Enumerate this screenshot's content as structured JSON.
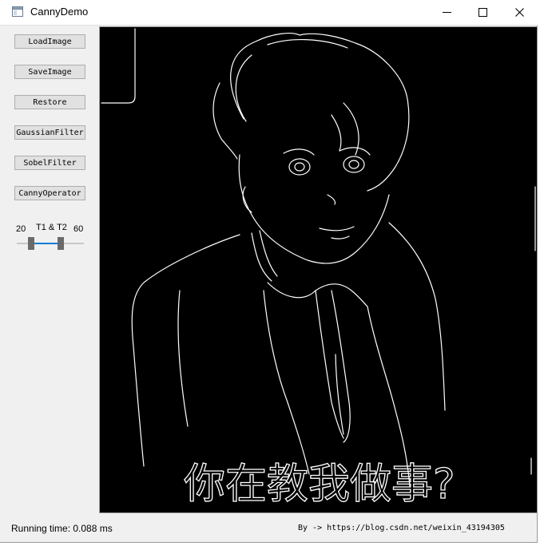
{
  "window": {
    "title": "CannyDemo",
    "buttons": {
      "minimize": "minimize",
      "maximize": "maximize",
      "close": "close"
    }
  },
  "sidebar": {
    "buttons": [
      {
        "label": "LoadImage"
      },
      {
        "label": "SaveImage"
      },
      {
        "label": "Restore"
      },
      {
        "label": "GaussianFilter"
      },
      {
        "label": "SobelFilter"
      },
      {
        "label": "CannyOperator"
      }
    ],
    "threshold": {
      "title": "T1 & T2",
      "low": "20",
      "high": "60"
    }
  },
  "image": {
    "caption": "你在教我做事?"
  },
  "status": {
    "running_time": "Running time: 0.088 ms",
    "credit": "By -> https://blog.csdn.net/weixin_43194305"
  },
  "icons": {
    "app": "app-window-icon",
    "minimize": "minimize-icon",
    "maximize": "maximize-icon",
    "close": "close-icon"
  }
}
